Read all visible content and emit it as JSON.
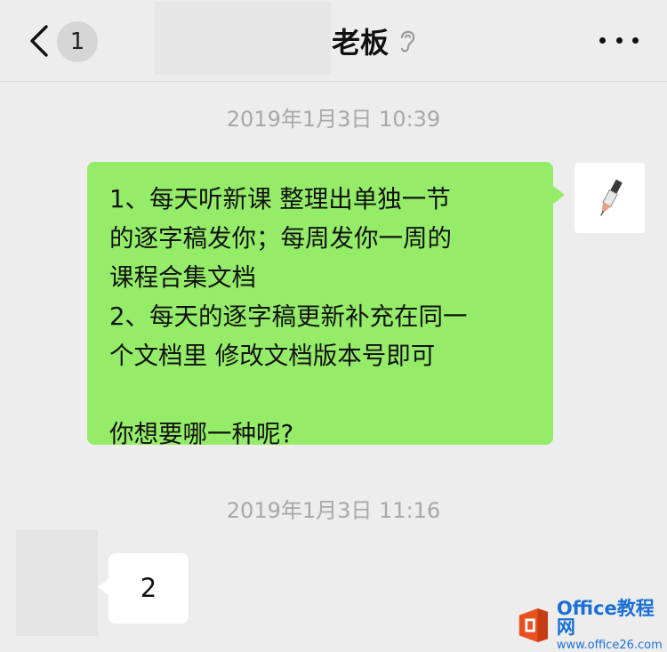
{
  "header": {
    "unread_count": "1",
    "title": "老板"
  },
  "messages": {
    "timestamp_1": "2019年1月3日 10:39",
    "sent_lines": [
      "1、每天听新课 整理出单独一节",
      "的逐字稿发你；每周发你一周的",
      "课程合集文档",
      "2、每天的逐字稿更新补充在同一",
      "个文档里 修改文档版本号即可",
      "",
      "你想要哪一种呢?"
    ],
    "timestamp_2": "2019年1月3日 11:16",
    "received_text": "2"
  },
  "watermark": {
    "title": "Office教程网",
    "url": "www.office26.com"
  },
  "colors": {
    "sent_bubble": "#95ec69",
    "received_bubble": "#ffffff",
    "background": "#ededed",
    "watermark_blue": "#1a6fd6",
    "office_orange": "#e8501f"
  },
  "icons": {
    "back": "chevron-left-icon",
    "ear": "ear-icon",
    "more": "more-dots-icon",
    "avatar_me": "pen-drawing-avatar",
    "office_logo": "office-logo-icon"
  }
}
